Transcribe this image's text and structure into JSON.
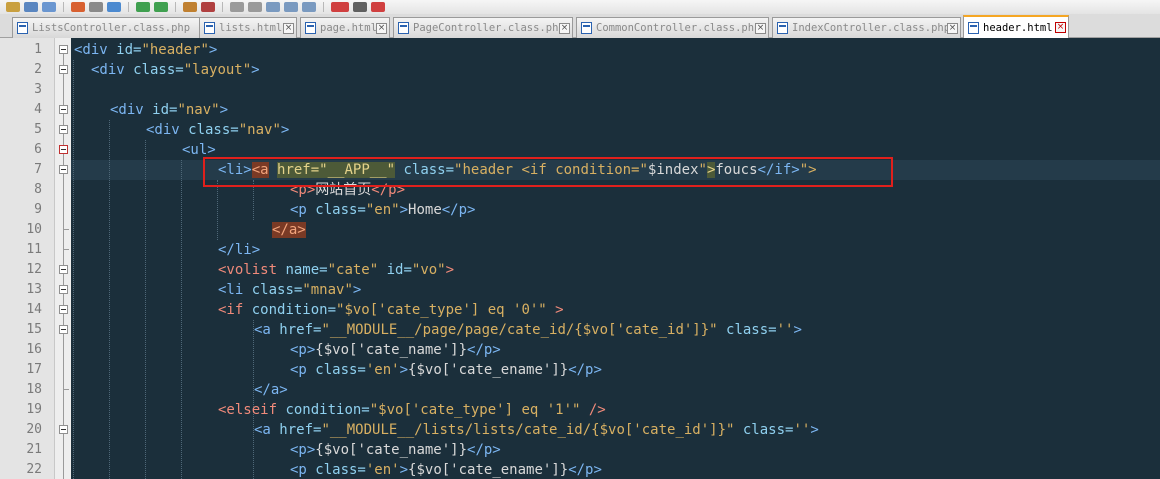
{
  "tabs": [
    {
      "label": "ListsController.class.php",
      "active": false
    },
    {
      "label": "lists.html",
      "active": false
    },
    {
      "label": "page.html",
      "active": false
    },
    {
      "label": "PageController.class.php",
      "active": false
    },
    {
      "label": "CommonController.class.php",
      "active": false
    },
    {
      "label": "IndexController.class.php",
      "active": false
    },
    {
      "label": "header.html",
      "active": true
    }
  ],
  "tab_close_symbol": "×",
  "line_numbers": [
    "1",
    "2",
    "3",
    "4",
    "5",
    "6",
    "7",
    "8",
    "9",
    "10",
    "11",
    "12",
    "13",
    "14",
    "15",
    "16",
    "17",
    "18",
    "19",
    "20",
    "21",
    "22"
  ],
  "code": {
    "l1": {
      "open": "<div",
      "attr": " id=",
      "val": "\"header\"",
      "close": ">"
    },
    "l2": {
      "open": "<div",
      "attr": " class=",
      "val": "\"layout\"",
      "close": ">"
    },
    "l4": {
      "open": "<div",
      "attr": " id=",
      "val": "\"nav\"",
      "close": ">"
    },
    "l5": {
      "open": "<div",
      "attr": " class=",
      "val": "\"nav\"",
      "close": ">"
    },
    "l6": {
      "tag": "<ul>"
    },
    "l7": {
      "li": "<li>",
      "a_open": "<a",
      "href_attr": "href=",
      "href_val": "\"__APP__\"",
      "class_attr": " class=",
      "class_val_start": "\"header <if condition=\"",
      "cond_val": "$index",
      "cond_q": "\"",
      "gt": ">",
      "foucs": "foucs",
      "endif": "</if>",
      "tail": "\">"
    },
    "l8": {
      "open": "<p>",
      "text": "网站首页",
      "close": "</p>"
    },
    "l9": {
      "open": "<p",
      "attr": " class=",
      "val": "\"en\"",
      "gt": ">",
      "text": "Home",
      "close": "</p>"
    },
    "l10": {
      "tag": "</a>"
    },
    "l11": {
      "tag": "</li>"
    },
    "l12": {
      "open": "<volist",
      "attr1": " name=",
      "val1": "\"cate\"",
      "attr2": " id=",
      "val2": "\"vo\"",
      "close": ">"
    },
    "l13": {
      "open": "<li",
      "attr": " class=",
      "val": "\"mnav\"",
      "close": ">"
    },
    "l14": {
      "open": "<if",
      "attr": " condition=",
      "val": "\"$vo['cate_type'] eq '0'\"",
      "close": " >"
    },
    "l15": {
      "open": "<a",
      "attr1": " href=",
      "val1": "\"__MODULE__/page/page/cate_id/{$vo['cate_id']}\"",
      "attr2": " class=",
      "val2": "''",
      "close": ">"
    },
    "l16": {
      "open": "<p>",
      "text": "{$vo['cate_name']}",
      "close": "</p>"
    },
    "l17": {
      "open": "<p",
      "attr": " class=",
      "val": "'en'",
      "gt": ">",
      "text": "{$vo['cate_ename']}",
      "close": "</p>"
    },
    "l18": {
      "tag": "</a>"
    },
    "l19": {
      "open": "<elseif",
      "attr": " condition=",
      "val": "\"$vo['cate_type'] eq '1'\"",
      "close": " />"
    },
    "l20": {
      "open": "<a",
      "attr1": " href=",
      "val1": "\"__MODULE__/lists/lists/cate_id/{$vo['cate_id']}\"",
      "attr2": " class=",
      "val2": "''",
      "close": ">"
    },
    "l21": {
      "open": "<p>",
      "text": "{$vo['cate_name']}",
      "close": "</p>"
    },
    "l22": {
      "open": "<p",
      "attr": " class=",
      "val": "'en'",
      "gt": ">",
      "text": "{$vo['cate_ename']}",
      "close": "</p>"
    }
  },
  "colors": {
    "editor_bg": "#1b2f3b",
    "tag": "#7cb6f2",
    "string": "#d8b062",
    "highlight_box": "#e0201c",
    "active_tab_accent": "#f5a623"
  }
}
